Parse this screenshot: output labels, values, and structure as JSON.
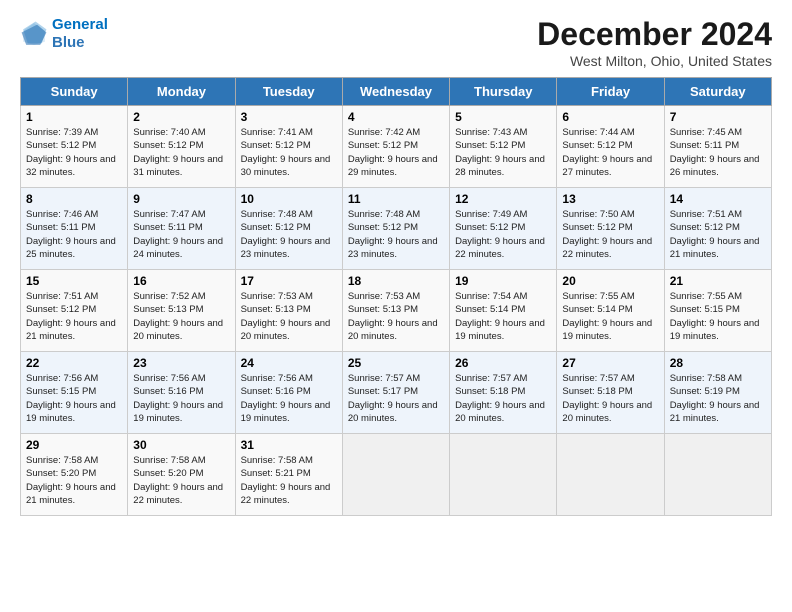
{
  "logo": {
    "line1": "General",
    "line2": "Blue"
  },
  "title": "December 2024",
  "subtitle": "West Milton, Ohio, United States",
  "days_of_week": [
    "Sunday",
    "Monday",
    "Tuesday",
    "Wednesday",
    "Thursday",
    "Friday",
    "Saturday"
  ],
  "weeks": [
    [
      {
        "day": 1,
        "info": "Sunrise: 7:39 AM\nSunset: 5:12 PM\nDaylight: 9 hours and 32 minutes."
      },
      {
        "day": 2,
        "info": "Sunrise: 7:40 AM\nSunset: 5:12 PM\nDaylight: 9 hours and 31 minutes."
      },
      {
        "day": 3,
        "info": "Sunrise: 7:41 AM\nSunset: 5:12 PM\nDaylight: 9 hours and 30 minutes."
      },
      {
        "day": 4,
        "info": "Sunrise: 7:42 AM\nSunset: 5:12 PM\nDaylight: 9 hours and 29 minutes."
      },
      {
        "day": 5,
        "info": "Sunrise: 7:43 AM\nSunset: 5:12 PM\nDaylight: 9 hours and 28 minutes."
      },
      {
        "day": 6,
        "info": "Sunrise: 7:44 AM\nSunset: 5:12 PM\nDaylight: 9 hours and 27 minutes."
      },
      {
        "day": 7,
        "info": "Sunrise: 7:45 AM\nSunset: 5:11 PM\nDaylight: 9 hours and 26 minutes."
      }
    ],
    [
      {
        "day": 8,
        "info": "Sunrise: 7:46 AM\nSunset: 5:11 PM\nDaylight: 9 hours and 25 minutes."
      },
      {
        "day": 9,
        "info": "Sunrise: 7:47 AM\nSunset: 5:11 PM\nDaylight: 9 hours and 24 minutes."
      },
      {
        "day": 10,
        "info": "Sunrise: 7:48 AM\nSunset: 5:12 PM\nDaylight: 9 hours and 23 minutes."
      },
      {
        "day": 11,
        "info": "Sunrise: 7:48 AM\nSunset: 5:12 PM\nDaylight: 9 hours and 23 minutes."
      },
      {
        "day": 12,
        "info": "Sunrise: 7:49 AM\nSunset: 5:12 PM\nDaylight: 9 hours and 22 minutes."
      },
      {
        "day": 13,
        "info": "Sunrise: 7:50 AM\nSunset: 5:12 PM\nDaylight: 9 hours and 22 minutes."
      },
      {
        "day": 14,
        "info": "Sunrise: 7:51 AM\nSunset: 5:12 PM\nDaylight: 9 hours and 21 minutes."
      }
    ],
    [
      {
        "day": 15,
        "info": "Sunrise: 7:51 AM\nSunset: 5:12 PM\nDaylight: 9 hours and 21 minutes."
      },
      {
        "day": 16,
        "info": "Sunrise: 7:52 AM\nSunset: 5:13 PM\nDaylight: 9 hours and 20 minutes."
      },
      {
        "day": 17,
        "info": "Sunrise: 7:53 AM\nSunset: 5:13 PM\nDaylight: 9 hours and 20 minutes."
      },
      {
        "day": 18,
        "info": "Sunrise: 7:53 AM\nSunset: 5:13 PM\nDaylight: 9 hours and 20 minutes."
      },
      {
        "day": 19,
        "info": "Sunrise: 7:54 AM\nSunset: 5:14 PM\nDaylight: 9 hours and 19 minutes."
      },
      {
        "day": 20,
        "info": "Sunrise: 7:55 AM\nSunset: 5:14 PM\nDaylight: 9 hours and 19 minutes."
      },
      {
        "day": 21,
        "info": "Sunrise: 7:55 AM\nSunset: 5:15 PM\nDaylight: 9 hours and 19 minutes."
      }
    ],
    [
      {
        "day": 22,
        "info": "Sunrise: 7:56 AM\nSunset: 5:15 PM\nDaylight: 9 hours and 19 minutes."
      },
      {
        "day": 23,
        "info": "Sunrise: 7:56 AM\nSunset: 5:16 PM\nDaylight: 9 hours and 19 minutes."
      },
      {
        "day": 24,
        "info": "Sunrise: 7:56 AM\nSunset: 5:16 PM\nDaylight: 9 hours and 19 minutes."
      },
      {
        "day": 25,
        "info": "Sunrise: 7:57 AM\nSunset: 5:17 PM\nDaylight: 9 hours and 20 minutes."
      },
      {
        "day": 26,
        "info": "Sunrise: 7:57 AM\nSunset: 5:18 PM\nDaylight: 9 hours and 20 minutes."
      },
      {
        "day": 27,
        "info": "Sunrise: 7:57 AM\nSunset: 5:18 PM\nDaylight: 9 hours and 20 minutes."
      },
      {
        "day": 28,
        "info": "Sunrise: 7:58 AM\nSunset: 5:19 PM\nDaylight: 9 hours and 21 minutes."
      }
    ],
    [
      {
        "day": 29,
        "info": "Sunrise: 7:58 AM\nSunset: 5:20 PM\nDaylight: 9 hours and 21 minutes."
      },
      {
        "day": 30,
        "info": "Sunrise: 7:58 AM\nSunset: 5:20 PM\nDaylight: 9 hours and 22 minutes."
      },
      {
        "day": 31,
        "info": "Sunrise: 7:58 AM\nSunset: 5:21 PM\nDaylight: 9 hours and 22 minutes."
      },
      null,
      null,
      null,
      null
    ]
  ]
}
